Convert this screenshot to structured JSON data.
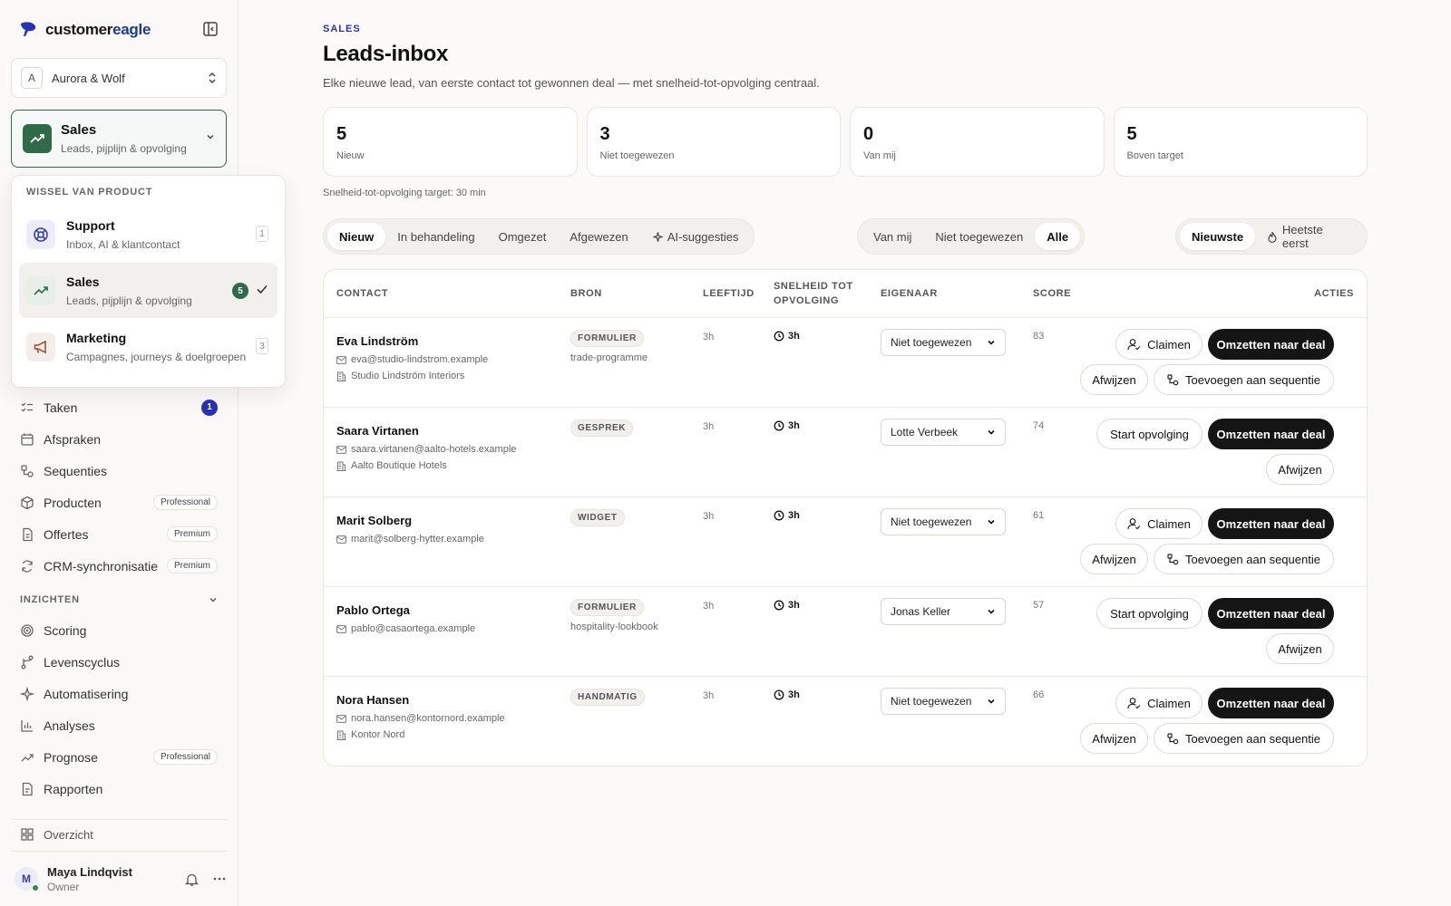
{
  "brand": {
    "name_main": "customer",
    "name_accent": "eagle"
  },
  "org": {
    "avatar": "A",
    "name": "Aurora & Wolf"
  },
  "product": {
    "title": "Sales",
    "subtitle": "Leads, pijplijn & opvolging"
  },
  "product_menu": {
    "heading": "WISSEL VAN PRODUCT",
    "items": [
      {
        "title": "Support",
        "subtitle": "Inbox, AI & klantcontact",
        "count": "1"
      },
      {
        "title": "Sales",
        "subtitle": "Leads, pijplijn & opvolging",
        "count": "5"
      },
      {
        "title": "Marketing",
        "subtitle": "Campagnes, journeys & doelgroepen",
        "count": "3"
      }
    ]
  },
  "nav": {
    "items": [
      {
        "label": "Taken",
        "count": "1"
      },
      {
        "label": "Afspraken"
      },
      {
        "label": "Sequenties"
      },
      {
        "label": "Producten",
        "tag": "Professional"
      },
      {
        "label": "Offertes",
        "tag": "Premium"
      },
      {
        "label": "CRM-synchronisatie",
        "tag": "Premium"
      }
    ],
    "section_label": "INZICHTEN",
    "insights": [
      {
        "label": "Scoring"
      },
      {
        "label": "Levenscyclus"
      },
      {
        "label": "Automatisering"
      },
      {
        "label": "Analyses"
      },
      {
        "label": "Prognose",
        "tag": "Professional"
      },
      {
        "label": "Rapporten"
      }
    ],
    "overview": "Overzicht"
  },
  "user": {
    "initial": "M",
    "name": "Maya Lindqvist",
    "role": "Owner"
  },
  "page": {
    "eyebrow": "SALES",
    "title": "Leads-inbox",
    "subtitle": "Elke nieuwe lead, van eerste contact tot gewonnen deal — met snelheid-tot-opvolging centraal.",
    "target_note": "Snelheid-tot-opvolging target: 30 min"
  },
  "stats": [
    {
      "value": "5",
      "label": "Nieuw"
    },
    {
      "value": "3",
      "label": "Niet toegewezen"
    },
    {
      "value": "0",
      "label": "Van mij"
    },
    {
      "value": "5",
      "label": "Boven target"
    }
  ],
  "status_tabs": [
    "Nieuw",
    "In behandeling",
    "Omgezet",
    "Afgewezen",
    "AI-suggesties"
  ],
  "owner_filters": [
    "Van mij",
    "Niet toegewezen",
    "Alle"
  ],
  "sort_options": [
    "Nieuwste",
    "Heetste eerst"
  ],
  "table": {
    "headers": {
      "contact": "CONTACT",
      "source": "BRON",
      "age": "LEEFTIJD",
      "speed_1": "SNELHEID TOT",
      "speed_2": "OPVOLGING",
      "owner": "EIGENAAR",
      "score": "SCORE",
      "actions": "ACTIES"
    },
    "labels": {
      "claim": "Claimen",
      "convert": "Omzetten naar deal",
      "reject": "Afwijzen",
      "add_sequence": "Toevoegen aan sequentie",
      "start": "Start opvolging"
    },
    "rows": [
      {
        "name": "Eva Lindström",
        "email": "eva@studio-lindstrom.example",
        "company": "Studio Lindström Interiors",
        "source": "FORMULIER",
        "source_detail": "trade-programme",
        "age": "3h",
        "speed": "3h",
        "owner": "Niet toegewezen",
        "score": "83"
      },
      {
        "name": "Saara Virtanen",
        "email": "saara.virtanen@aalto-hotels.example",
        "company": "Aalto Boutique Hotels",
        "source": "GESPREK",
        "source_detail": "",
        "age": "3h",
        "speed": "3h",
        "owner": "Lotte Verbeek",
        "score": "74"
      },
      {
        "name": "Marit Solberg",
        "email": "marit@solberg-hytter.example",
        "company": "",
        "source": "WIDGET",
        "source_detail": "",
        "age": "3h",
        "speed": "3h",
        "owner": "Niet toegewezen",
        "score": "61"
      },
      {
        "name": "Pablo Ortega",
        "email": "pablo@casaortega.example",
        "company": "",
        "source": "FORMULIER",
        "source_detail": "hospitality-lookbook",
        "age": "3h",
        "speed": "3h",
        "owner": "Jonas Keller",
        "score": "57"
      },
      {
        "name": "Nora Hansen",
        "email": "nora.hansen@kontornord.example",
        "company": "Kontor Nord",
        "source": "HANDMATIG",
        "source_detail": "",
        "age": "3h",
        "speed": "3h",
        "owner": "Niet toegewezen",
        "score": "66"
      }
    ]
  }
}
